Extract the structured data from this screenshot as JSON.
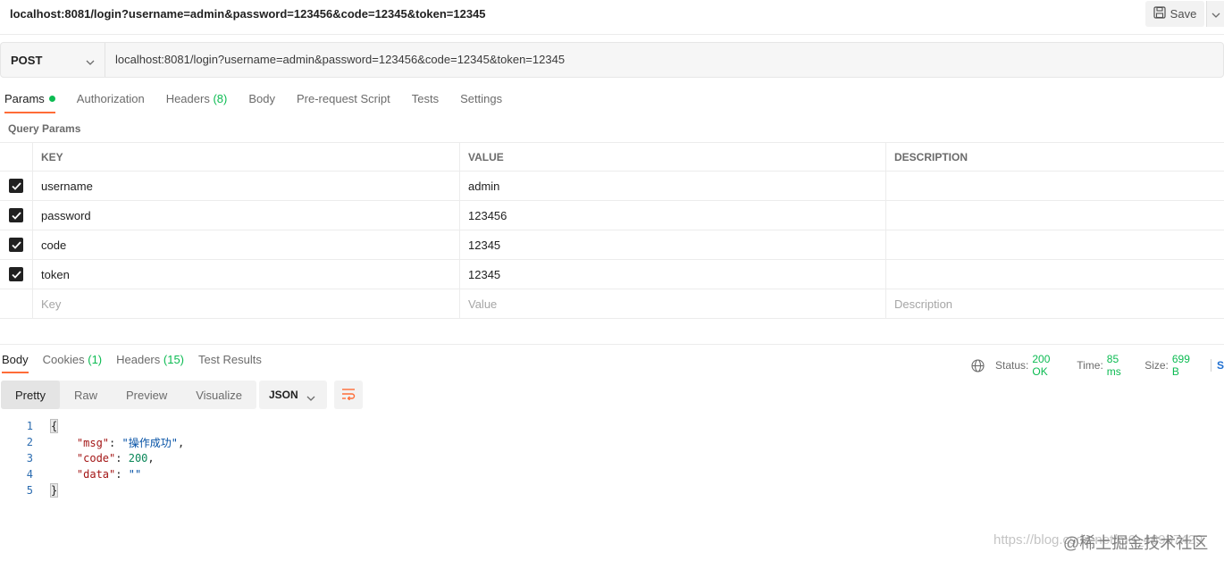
{
  "request": {
    "name": "localhost:8081/login?username=admin&password=123456&code=12345&token=12345",
    "method": "POST",
    "url": "localhost:8081/login?username=admin&password=123456&code=12345&token=12345",
    "save_label": "Save"
  },
  "tabs": {
    "params": "Params",
    "authorization": "Authorization",
    "headers": "Headers",
    "headers_count": "(8)",
    "body": "Body",
    "prerequest": "Pre-request Script",
    "tests": "Tests",
    "settings": "Settings"
  },
  "query_params": {
    "title": "Query Params",
    "columns": [
      "KEY",
      "VALUE",
      "DESCRIPTION"
    ],
    "rows": [
      {
        "key": "username",
        "value": "admin",
        "description": ""
      },
      {
        "key": "password",
        "value": "123456",
        "description": ""
      },
      {
        "key": "code",
        "value": "12345",
        "description": ""
      },
      {
        "key": "token",
        "value": "12345",
        "description": ""
      }
    ],
    "placeholders": {
      "key": "Key",
      "value": "Value",
      "description": "Description"
    }
  },
  "response": {
    "tabs": {
      "body": "Body",
      "cookies": "Cookies",
      "cookies_count": "(1)",
      "headers": "Headers",
      "headers_count": "(15)",
      "test_results": "Test Results"
    },
    "status_label": "Status:",
    "status_value": "200 OK",
    "time_label": "Time:",
    "time_value": "85 ms",
    "size_label": "Size:",
    "size_value": "699 B",
    "trailing_glyph": "S",
    "views": [
      "Pretty",
      "Raw",
      "Preview",
      "Visualize"
    ],
    "format": "JSON",
    "lines": [
      "1",
      "2",
      "3",
      "4",
      "5"
    ],
    "json": {
      "open": "{",
      "k1": "\"msg\"",
      "v1": "\"操作成功\"",
      "k2": "\"code\"",
      "v2": "200",
      "k3": "\"data\"",
      "v3": "\"\"",
      "close": "}"
    }
  },
  "watermark": {
    "url": "https://blog.csdn.net/m0_46937429",
    "brand": "@稀土掘金技术社区"
  }
}
